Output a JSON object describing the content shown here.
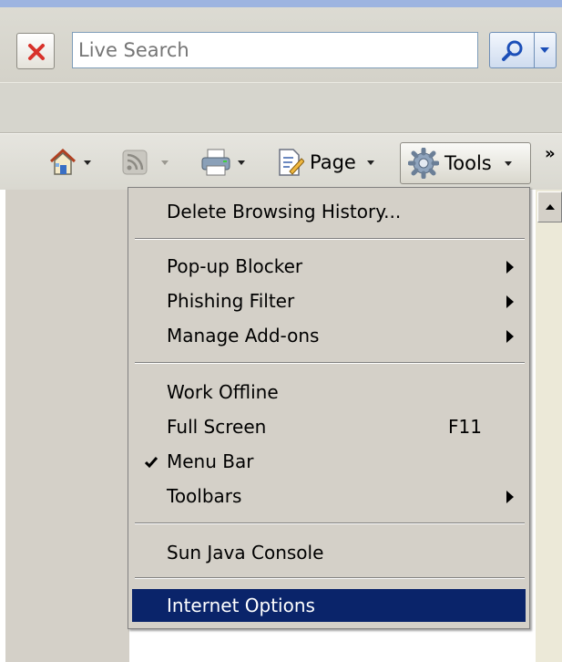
{
  "search": {
    "placeholder": "Live Search",
    "value": ""
  },
  "command_bar": {
    "page_label": "Page",
    "tools_label": "Tools",
    "overflow_glyph": "»"
  },
  "tools_menu": {
    "items": [
      {
        "label": "Delete Browsing History..."
      },
      {
        "label": "Pop-up Blocker"
      },
      {
        "label": "Phishing Filter"
      },
      {
        "label": "Manage Add-ons"
      },
      {
        "label": "Work Offline"
      },
      {
        "label": "Full Screen",
        "shortcut": "F11"
      },
      {
        "label": "Menu Bar"
      },
      {
        "label": "Toolbars"
      },
      {
        "label": "Sun Java Console"
      },
      {
        "label": "Internet Options"
      }
    ]
  },
  "colors": {
    "highlight": "#0a246a",
    "menu_bg": "#d4d0c8"
  },
  "icons": {
    "stop": "close-icon",
    "search": "magnifier-icon",
    "home": "home-icon",
    "feeds": "feed-icon",
    "print": "printer-icon",
    "page": "page-icon",
    "tools": "gear-icon"
  }
}
